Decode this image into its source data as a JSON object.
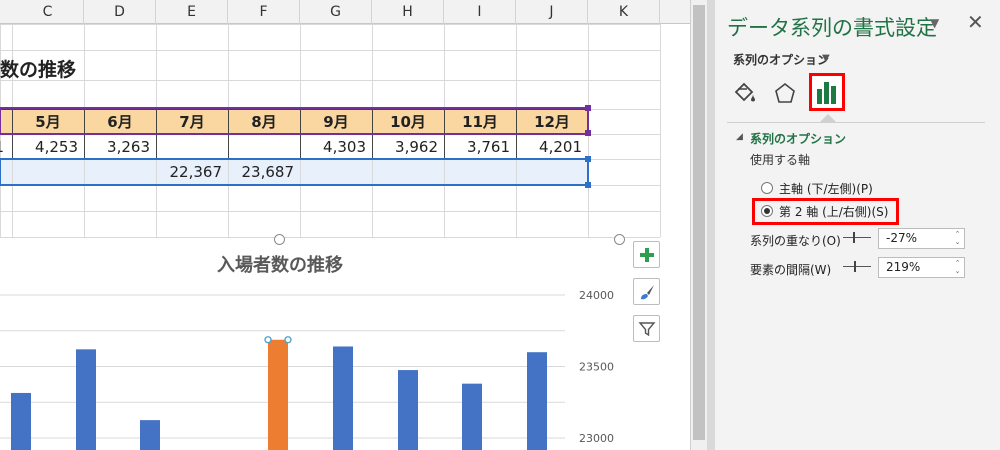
{
  "sheet": {
    "columns": [
      "C",
      "D",
      "E",
      "F",
      "G",
      "H",
      "I",
      "J",
      "K"
    ],
    "title": "数の推移",
    "month_headers": [
      "5月",
      "6月",
      "7月",
      "8月",
      "9月",
      "10月",
      "11月",
      "12月"
    ],
    "row1": {
      "prefix": "1",
      "values": [
        "4,253",
        "3,263",
        "",
        "",
        "4,303",
        "3,962",
        "3,761",
        "4,201"
      ]
    },
    "row2": {
      "values": [
        "",
        "",
        "22,367",
        "23,687",
        "",
        "",
        "",
        ""
      ]
    },
    "colors": {
      "header_fill": "#fad7a0",
      "row_highlight": "#e8f0fb",
      "selection_purple": "#7030a0",
      "selection_blue": "#2e6fc7"
    }
  },
  "chart": {
    "title": "入場者数の推移",
    "tools": {
      "add": "chart-elements-icon",
      "style": "chart-style-icon",
      "filter": "chart-filter-icon"
    }
  },
  "chart_data": {
    "type": "bar",
    "title": "入場者数の推移",
    "secondary_axis": {
      "ticks": [
        24000,
        23500,
        23000
      ],
      "range": [
        22800,
        24200
      ]
    },
    "series": [
      {
        "name": "",
        "color": "#4472c4",
        "values": [
          23315,
          23620,
          23125,
          23640,
          23475,
          23380,
          23600
        ]
      },
      {
        "name": "",
        "color": "#ed7d31",
        "values": [
          23687
        ]
      }
    ],
    "highlighted_value": 23687,
    "grid": true
  },
  "pane": {
    "title": "データ系列の書式設定",
    "series_options_label": "系列のオプション",
    "section_label": "系列のオプション",
    "axis_label": "使用する軸",
    "primary_axis": "主軸 (下/左側)(P)",
    "secondary_axis": "第 2 軸 (上/右側)(S)",
    "overlap_label": "系列の重なり(O)",
    "overlap_value": "-27%",
    "gap_label": "要素の間隔(W)",
    "gap_value": "219%",
    "overlap_level": 0.37,
    "gap_level": 0.44,
    "icons": [
      "fill-line-icon",
      "effects-icon",
      "series-options-icon"
    ],
    "accent": "#217346",
    "highlight": "#ff0000"
  }
}
